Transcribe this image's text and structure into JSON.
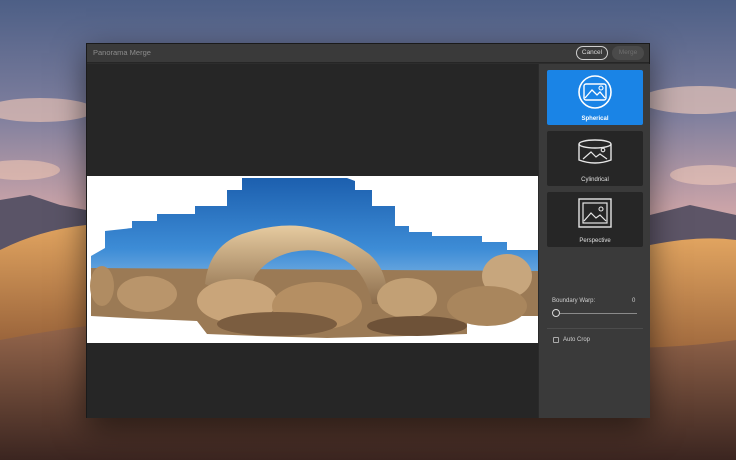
{
  "dialog": {
    "title": "Panorama Merge",
    "cancel_label": "Cancel",
    "merge_label": "Merge"
  },
  "projections": [
    {
      "label": "Spherical",
      "icon": "spherical-icon",
      "selected": true
    },
    {
      "label": "Cylindrical",
      "icon": "cylindrical-icon",
      "selected": false
    },
    {
      "label": "Perspective",
      "icon": "perspective-icon",
      "selected": false
    }
  ],
  "boundary_warp": {
    "label": "Boundary Warp:",
    "value": "0"
  },
  "auto_crop": {
    "label": "Auto Crop",
    "checked": false
  },
  "colors": {
    "accent": "#1a84e6",
    "dialog_bg": "#2d2d2d",
    "panel_bg": "#3a3a3a",
    "preview_bg": "#262626"
  }
}
